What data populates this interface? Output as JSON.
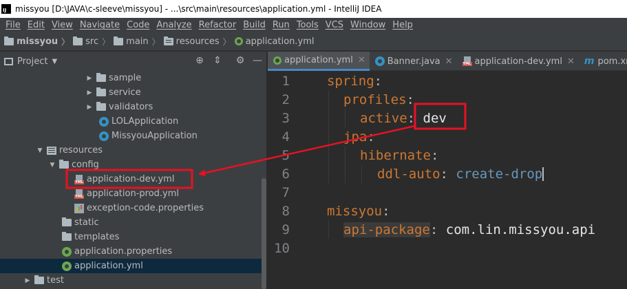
{
  "window": {
    "title": "missyou [D:\\JAVA\\c-sleeve\\missyou] - ...\\src\\main\\resources\\application.yml - IntelliJ IDEA",
    "logo_text": "IJ"
  },
  "menu": [
    "File",
    "Edit",
    "View",
    "Navigate",
    "Code",
    "Analyze",
    "Refactor",
    "Build",
    "Run",
    "Tools",
    "VCS",
    "Window",
    "Help"
  ],
  "breadcrumb": [
    "missyou",
    "src",
    "main",
    "resources",
    "application.yml"
  ],
  "project_panel": {
    "title": "Project",
    "tree": [
      {
        "label": "sample",
        "type": "folder",
        "arrow": "▶"
      },
      {
        "label": "service",
        "type": "folder",
        "arrow": "▶"
      },
      {
        "label": "validators",
        "type": "folder",
        "arrow": "▶"
      },
      {
        "label": "LOLApplication",
        "type": "class",
        "arrow": ""
      },
      {
        "label": "MissyouApplication",
        "type": "class",
        "arrow": ""
      },
      {
        "label": "resources",
        "type": "folder-res",
        "arrow": "▼"
      },
      {
        "label": "config",
        "type": "folder",
        "arrow": "▼"
      },
      {
        "label": "application-dev.yml",
        "type": "yml",
        "arrow": ""
      },
      {
        "label": "application-prod.yml",
        "type": "yml",
        "arrow": ""
      },
      {
        "label": "exception-code.properties",
        "type": "props",
        "arrow": ""
      },
      {
        "label": "static",
        "type": "folder",
        "arrow": ""
      },
      {
        "label": "templates",
        "type": "folder",
        "arrow": ""
      },
      {
        "label": "application.properties",
        "type": "spring",
        "arrow": ""
      },
      {
        "label": "application.yml",
        "type": "spring",
        "arrow": ""
      },
      {
        "label": "test",
        "type": "folder",
        "arrow": "▶"
      }
    ]
  },
  "tabs": [
    {
      "label": "application.yml",
      "icon": "spring-icon",
      "active": true
    },
    {
      "label": "Banner.java",
      "icon": "class-icon",
      "active": false
    },
    {
      "label": "application-dev.yml",
      "icon": "yml-icon",
      "active": false
    },
    {
      "label": "pom.xml",
      "icon": "maven-icon",
      "active": false
    }
  ],
  "code": {
    "line_numbers": [
      "1",
      "2",
      "3",
      "4",
      "5",
      "6",
      "7",
      "8",
      "9",
      "10"
    ],
    "l1_key": "spring",
    "l2_key": "profiles",
    "l3_key": "active",
    "l3_value": "dev",
    "l4_key": "jpa",
    "l5_key": "hibernate",
    "l6_key": "ddl-auto",
    "l6_value": "create-drop",
    "l8_key": "missyou",
    "l9_key": "api-package",
    "l9_value": "com.lin.missyou.api",
    "colon": ":"
  },
  "colors": {
    "annotation_red": "#e81123",
    "selection": "#0d293e",
    "tab_underline": "#4a88c7"
  }
}
